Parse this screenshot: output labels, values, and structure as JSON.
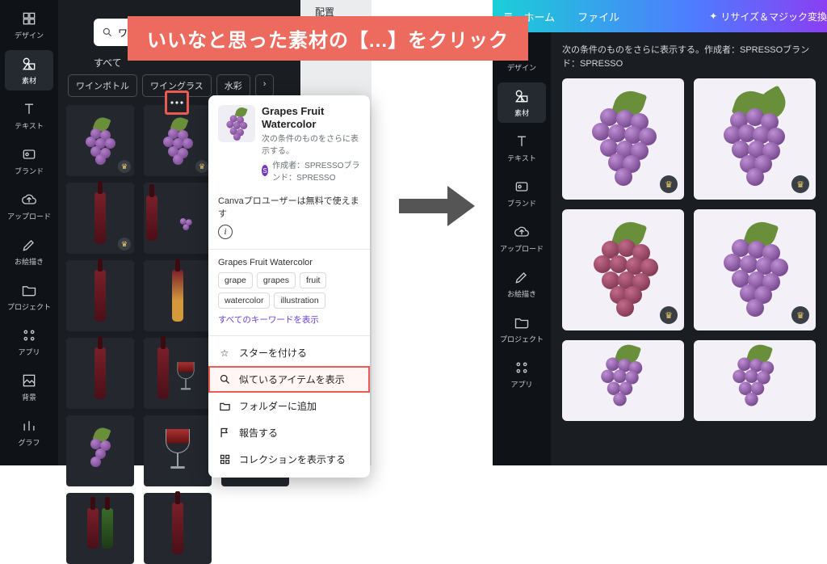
{
  "callout": "いいなと思った素材の【...】をクリック",
  "rail": {
    "items": [
      {
        "label": "デザイン"
      },
      {
        "label": "素材"
      },
      {
        "label": "テキスト"
      },
      {
        "label": "ブランド"
      },
      {
        "label": "アップロード"
      },
      {
        "label": "お絵描き"
      },
      {
        "label": "プロジェクト"
      },
      {
        "label": "アプリ"
      },
      {
        "label": "背景"
      },
      {
        "label": "グラフ"
      }
    ]
  },
  "left_panel": {
    "search_value": "ワイン　水彩",
    "filters": {
      "all": "すべて"
    },
    "chips": [
      "ワインボトル",
      "ワイングラス",
      "水彩"
    ]
  },
  "canvas": {
    "tab": "配置"
  },
  "popup": {
    "title": "Grapes Fruit Watercolor",
    "condition": "次の条件のものをさらに表示する。",
    "author_line": "作成者：SPRESSOブランド：SPRESSO",
    "author_initial": "S",
    "note": "Canvaプロユーザーは無料で使えます",
    "label": "Grapes Fruit Watercolor",
    "tags": [
      "grape",
      "grapes",
      "fruit",
      "watercolor",
      "illustration"
    ],
    "show_all": "すべてのキーワードを表示",
    "menu": {
      "star": "スターを付ける",
      "similar": "似ているアイテムを表示",
      "folder": "フォルダーに追加",
      "report": "報告する",
      "collection": "コレクションを表示する"
    }
  },
  "right_top": {
    "home": "ホーム",
    "file": "ファイル",
    "resize": "リサイズ＆マジック変換"
  },
  "right_panel": {
    "condition": "次の条件のものをさらに表示する。作成者：SPRESSOブランド：SPRESSO"
  }
}
